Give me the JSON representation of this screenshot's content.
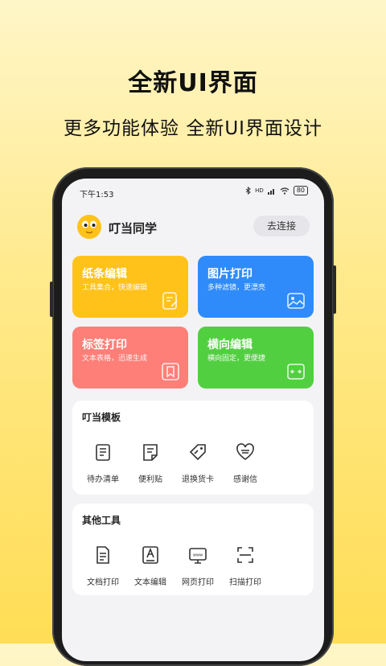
{
  "promo": {
    "headline": "全新UI界面",
    "subline": "更多功能体验 全新UI界面设计"
  },
  "status_bar": {
    "time": "下午1:53",
    "signal": "HD",
    "battery": "80"
  },
  "header": {
    "app_name": "叮当同学",
    "connect_label": "去连接"
  },
  "feature_cards": [
    {
      "title": "纸条编辑",
      "subtitle": "工具集合，快速编辑",
      "color": "#ffc21a",
      "icon": "edit-note-icon"
    },
    {
      "title": "图片打印",
      "subtitle": "多种滤镜，更漂亮",
      "color": "#2f8bfa",
      "icon": "image-icon"
    },
    {
      "title": "标签打印",
      "subtitle": "文本表格，迅速生成",
      "color": "#fd7f78",
      "icon": "bookmark-icon"
    },
    {
      "title": "横向编辑",
      "subtitle": "横向固定，更便捷",
      "color": "#52cf41",
      "icon": "horizontal-arrows-icon"
    }
  ],
  "templates": {
    "title": "叮当模板",
    "items": [
      {
        "label": "待办清单",
        "icon": "checklist-icon"
      },
      {
        "label": "便利贴",
        "icon": "sticky-note-icon"
      },
      {
        "label": "退换货卡",
        "icon": "tag-icon"
      },
      {
        "label": "感谢信",
        "icon": "heart-letter-icon"
      }
    ]
  },
  "tools": {
    "title": "其他工具",
    "items": [
      {
        "label": "文档打印",
        "icon": "document-icon"
      },
      {
        "label": "文本编辑",
        "icon": "text-edit-icon"
      },
      {
        "label": "网页打印",
        "icon": "web-icon"
      },
      {
        "label": "扫描打印",
        "icon": "scan-icon"
      }
    ]
  }
}
